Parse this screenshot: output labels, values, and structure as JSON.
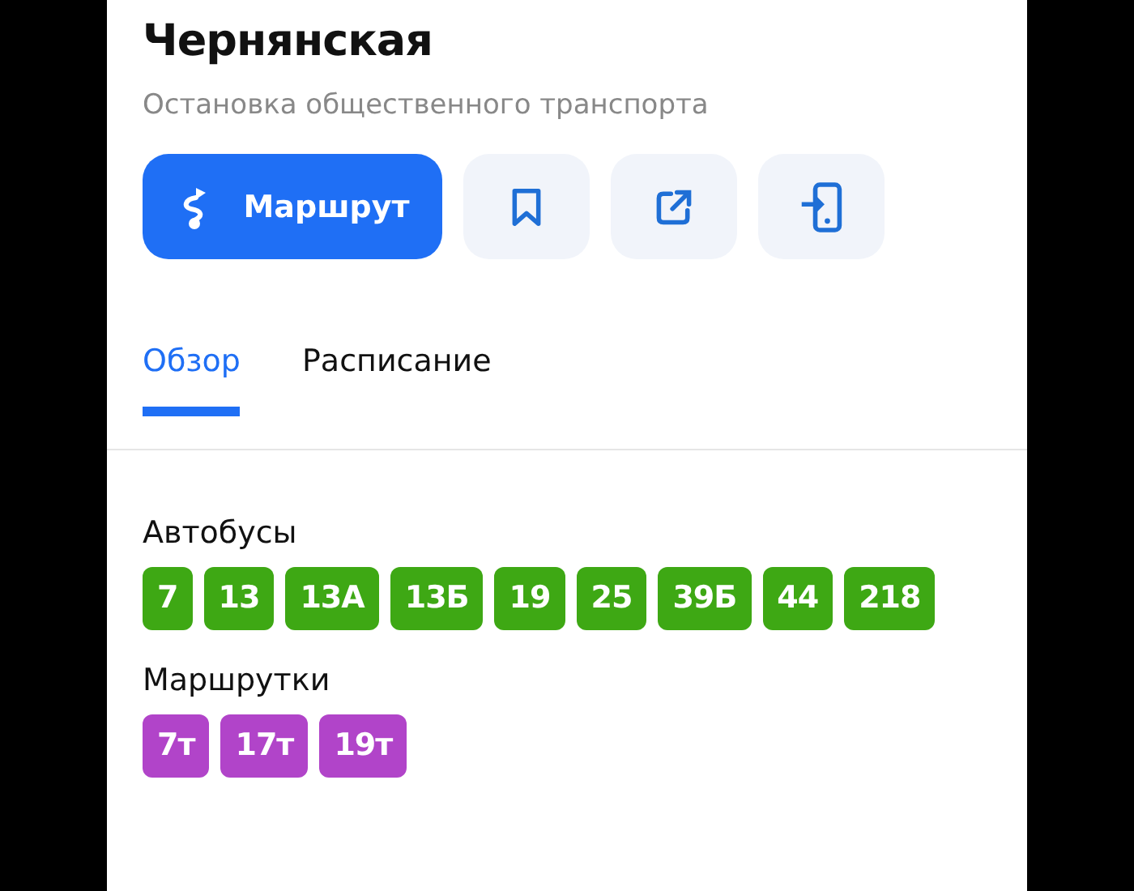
{
  "title": "Чернянская",
  "subtitle": "Остановка общественного транспорта",
  "actions": [
    {
      "kind": "route",
      "label": "Маршрут"
    },
    {
      "kind": "bookmark"
    },
    {
      "kind": "share"
    },
    {
      "kind": "send-to-phone"
    }
  ],
  "tabs": [
    {
      "label": "Обзор",
      "selected": true
    },
    {
      "label": "Расписание",
      "selected": false
    }
  ],
  "groups": [
    {
      "title": "Автобусы",
      "color": "#3ea814",
      "routes": [
        "7",
        "13",
        "13А",
        "13Б",
        "19",
        "25",
        "39Б",
        "44",
        "218"
      ]
    },
    {
      "title": "Маршрутки",
      "color": "#b144c9",
      "routes": [
        "7т",
        "17т",
        "19т"
      ]
    }
  ]
}
